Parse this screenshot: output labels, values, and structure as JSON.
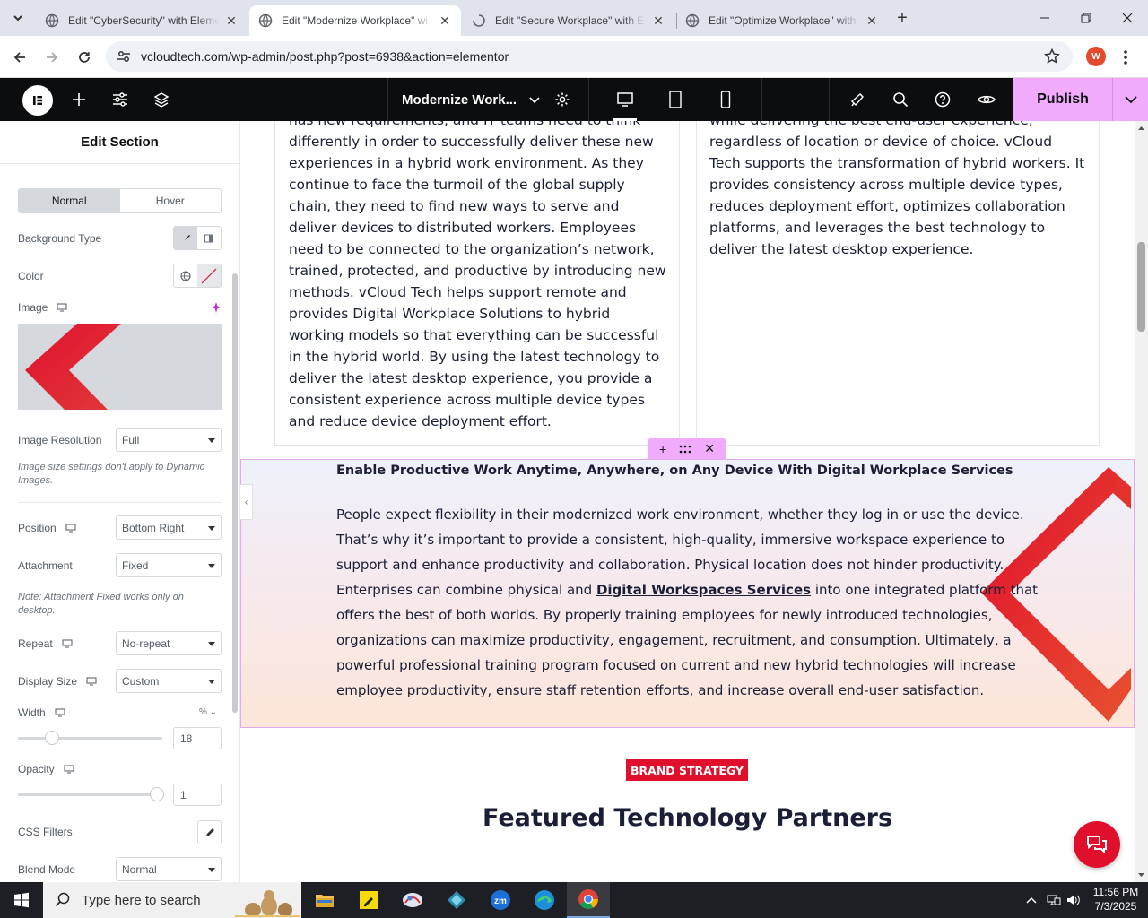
{
  "browser": {
    "tabs": [
      {
        "title": "Edit \"CyberSecurity\" with Eleme",
        "active": false
      },
      {
        "title": "Edit \"Modernize Workplace\" wi",
        "active": true
      },
      {
        "title": "Edit \"Secure Workplace\" with El",
        "active": false
      },
      {
        "title": "Edit \"Optimize Workplace\" with",
        "active": false
      }
    ],
    "url": "vcloudtech.com/wp-admin/post.php?post=6938&action=elementor",
    "profile_initial": "W"
  },
  "editor": {
    "document_title": "Modernize Work...",
    "publish_label": "Publish"
  },
  "panel": {
    "title": "Edit Section",
    "state_tabs": [
      "Normal",
      "Hover"
    ],
    "background_type_label": "Background Type",
    "color_label": "Color",
    "image_label": "Image",
    "image_resolution": {
      "label": "Image Resolution",
      "value": "Full"
    },
    "image_note": "Image size settings don't apply to Dynamic Images.",
    "position": {
      "label": "Position",
      "value": "Bottom Right"
    },
    "attachment": {
      "label": "Attachment",
      "value": "Fixed"
    },
    "attachment_note": "Note: Attachment Fixed works only on desktop.",
    "repeat": {
      "label": "Repeat",
      "value": "No-repeat"
    },
    "display_size": {
      "label": "Display Size",
      "value": "Custom"
    },
    "width": {
      "label": "Width",
      "unit": "%",
      "value": "18",
      "slider_fraction": 0.18
    },
    "opacity": {
      "label": "Opacity",
      "value": "1",
      "slider_fraction": 1
    },
    "css_filters_label": "CSS Filters",
    "blend_mode": {
      "label": "Blend Mode",
      "value": "Normal"
    }
  },
  "canvas": {
    "left_column_text": "has new requirements, and IT teams need to think differently in order to successfully deliver these new experiences in a hybrid work environment. As they continue to face the turmoil of the global supply chain, they need to find new ways to serve and deliver devices to distributed workers. Employees need to be connected to the organization’s network, trained, protected, and productive by introducing new methods. vCloud Tech helps support remote and provides Digital Workplace Solutions to hybrid working models so that everything can be successful in the hybrid world. By using the latest technology to deliver the latest desktop experience, you provide a consistent experience across multiple device types and reduce device deployment effort.",
    "right_column_text": "while delivering the best end-user experience, regardless of location or device of choice. vCloud Tech supports the transformation of hybrid workers. It provides consistency across multiple device types, reduces deployment effort, optimizes collaboration platforms, and leverages the best technology to deliver the latest desktop experience.",
    "section_title": "Enable Productive Work Anytime, Anywhere, on Any Device With Digital Workplace Services",
    "section_body_before": "People expect flexibility in their modernized work environment, whether they log in or use the device. That’s why it’s important to provide a consistent, high-quality, immersive workspace experience to support and enhance productivity and collaboration. Physical location does not hinder productivity. Enterprises can combine physical and ",
    "section_link": "Digital Workspaces Services",
    "section_body_after": " into one integrated platform that offers the best of both worlds. By properly training employees for newly introduced technologies, organizations can maximize productivity, engagement, recruitment, and consumption. Ultimately, a powerful professional training program focused on current and new hybrid technologies will increase employee productivity, ensure staff retention efforts, and increase overall end-user satisfaction.",
    "badge": "BRAND STRATEGY",
    "heading": "Featured Technology Partners"
  },
  "taskbar": {
    "search_placeholder": "Type here to search",
    "time": "11:56 PM",
    "date": "7/3/2025"
  },
  "colors": {
    "accent": "#e0102d",
    "publish": "#f0abfc",
    "toolbar": "#0c0d0e"
  }
}
